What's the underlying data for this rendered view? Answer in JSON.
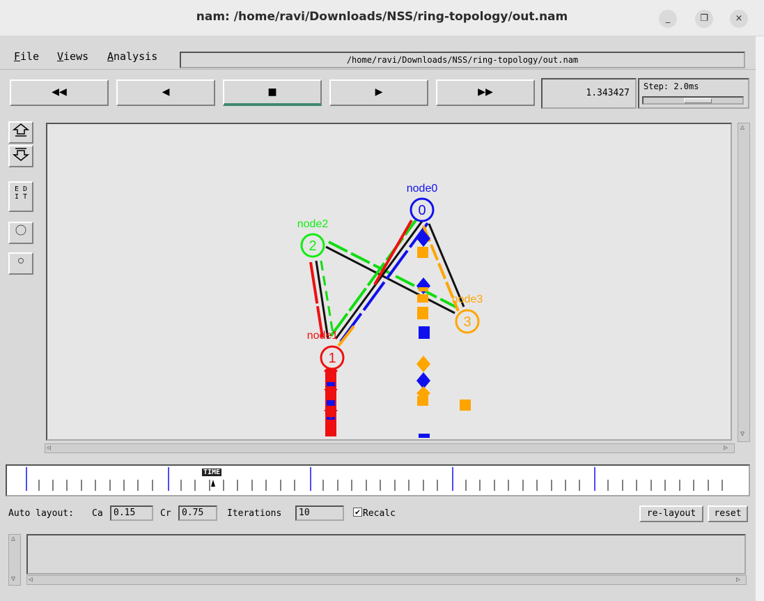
{
  "window": {
    "title": "nam: /home/ravi/Downloads/NSS/ring-topology/out.nam",
    "minimize_glyph": "_",
    "maximize_glyph": "❐",
    "close_glyph": "×"
  },
  "menu": {
    "file_u": "F",
    "file_rest": "ile",
    "views_u": "V",
    "views_rest": "iews",
    "analysis_u": "A",
    "analysis_rest": "nalysis",
    "path": "/home/ravi/Downloads/NSS/ring-topology/out.nam"
  },
  "controls": {
    "rewind": "◀◀",
    "back": "◀",
    "stop": "■",
    "play": "▶",
    "fast_forward": "▶▶",
    "time": "1.343427",
    "step_label": "Step: 2.0ms"
  },
  "toolbar": {
    "zoom_in_icon": "zoom-in-icon",
    "zoom_out_icon": "zoom-out-icon",
    "edit_label_1": "E D",
    "edit_label_2": "I T"
  },
  "network": {
    "nodes": [
      {
        "label": "node0",
        "id": "0",
        "color": "#1010ee"
      },
      {
        "label": "node1",
        "id": "1",
        "color": "#ee1010"
      },
      {
        "label": "node2",
        "id": "2",
        "color": "#10ee10"
      },
      {
        "label": "node3",
        "id": "3",
        "color": "#ffa500"
      }
    ]
  },
  "timeline": {
    "label": "TIME"
  },
  "autolayout": {
    "label": "Auto layout:",
    "ca_label": "Ca",
    "ca_value": "0.15",
    "cr_label": "Cr",
    "cr_value": "0.75",
    "iterations_label": "Iterations",
    "iterations_value": "10",
    "recalc_label": "Recalc",
    "recalc_checked": "✔",
    "relayout_label": "re-layout",
    "reset_label": "reset"
  },
  "colors": {
    "accent": "#3e8a6e",
    "background": "#d9d9d9",
    "canvas": "#e6e6e6"
  }
}
